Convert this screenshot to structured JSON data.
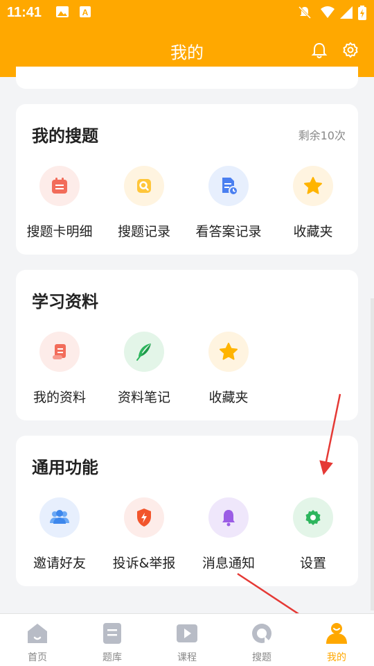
{
  "status": {
    "time": "11:41"
  },
  "header": {
    "title": "我的"
  },
  "sections": [
    {
      "title": "我的搜题",
      "extra": "剩余10次",
      "items": [
        {
          "label": "搜题卡明细",
          "icon": "card-detail-icon"
        },
        {
          "label": "搜题记录",
          "icon": "search-record-icon"
        },
        {
          "label": "看答案记录",
          "icon": "answer-record-icon"
        },
        {
          "label": "收藏夹",
          "icon": "star-icon"
        }
      ]
    },
    {
      "title": "学习资料",
      "items": [
        {
          "label": "我的资料",
          "icon": "scroll-icon"
        },
        {
          "label": "资料笔记",
          "icon": "feather-icon"
        },
        {
          "label": "收藏夹",
          "icon": "star-icon"
        }
      ]
    },
    {
      "title": "通用功能",
      "items": [
        {
          "label": "邀请好友",
          "icon": "invite-friends-icon"
        },
        {
          "label": "投诉&举报",
          "icon": "report-shield-icon"
        },
        {
          "label": "消息通知",
          "icon": "notification-bell-icon"
        },
        {
          "label": "设置",
          "icon": "settings-gear-icon"
        }
      ]
    }
  ],
  "tabs": [
    {
      "label": "首页",
      "icon": "home-icon",
      "active": false
    },
    {
      "label": "题库",
      "icon": "question-bank-icon",
      "active": false
    },
    {
      "label": "课程",
      "icon": "course-play-icon",
      "active": false
    },
    {
      "label": "搜题",
      "icon": "search-tab-icon",
      "active": false
    },
    {
      "label": "我的",
      "icon": "profile-icon",
      "active": true
    }
  ],
  "colors": {
    "brand": "#ffa800",
    "annotation_arrow": "#e53935"
  }
}
